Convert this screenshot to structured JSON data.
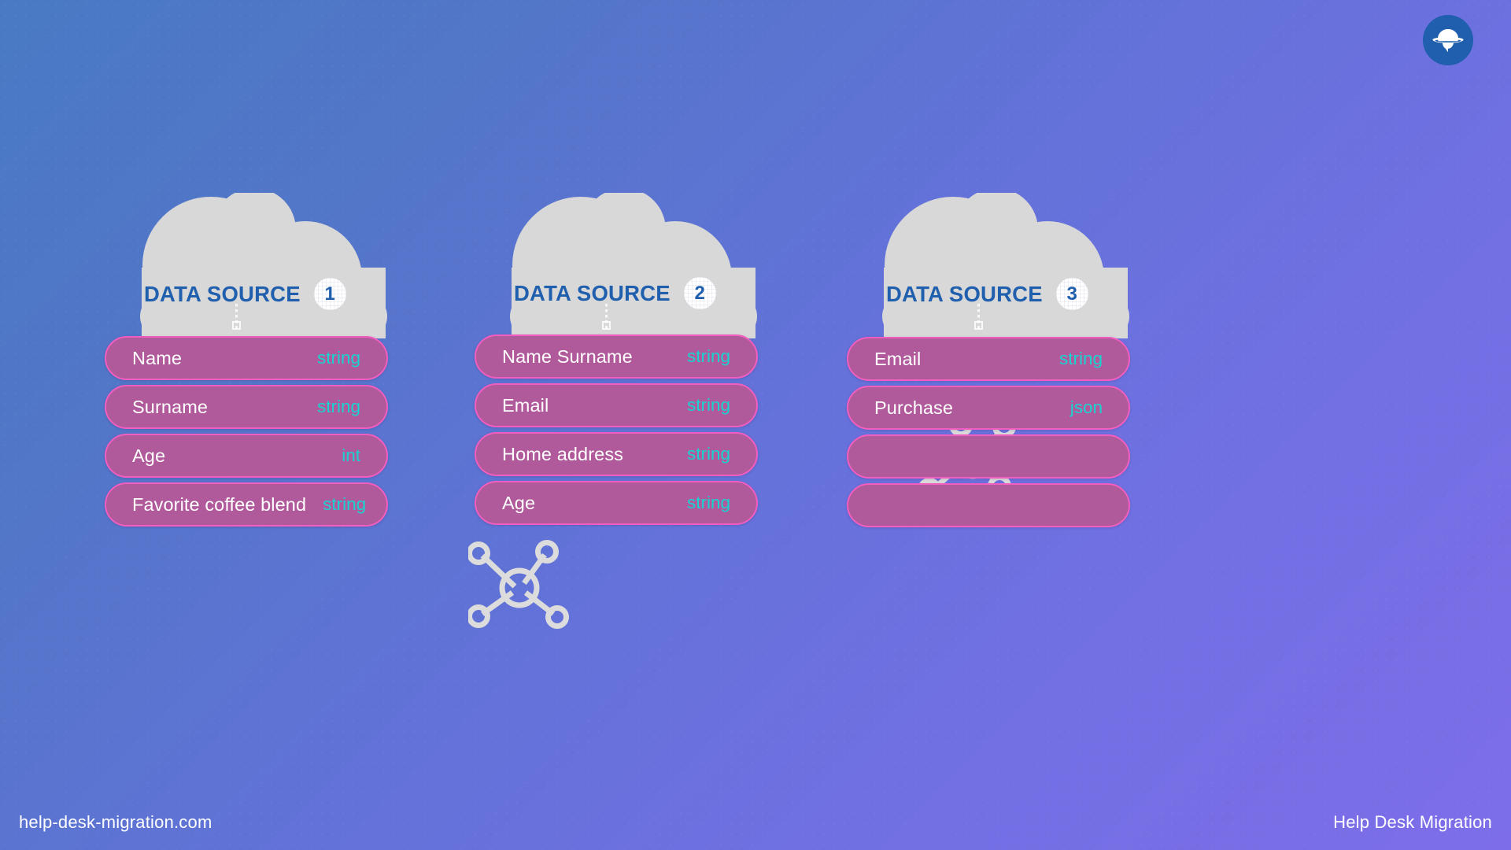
{
  "brand": {
    "logo_icon": "planet-logo-icon",
    "footer_left": "help-desk-migration.com",
    "footer_right": "Help Desk Migration",
    "accent_blue": "#1f5fae",
    "pill_fill": "#b15a9b",
    "pill_border": "#f25ec0",
    "type_color": "#18d3cf",
    "cloud_color": "#d8d8d8"
  },
  "columns": [
    {
      "title": "DATA SOURCE",
      "number": "1",
      "cloud_icon": "cloud-icon",
      "connector_icon": "dotted-connector-icon",
      "fields": [
        {
          "name": "Name",
          "type": "string"
        },
        {
          "name": "Surname",
          "type": "string"
        },
        {
          "name": "Age",
          "type": "int"
        },
        {
          "name": "Favorite coffee blend",
          "type": "string"
        }
      ]
    },
    {
      "title": "DATA SOURCE",
      "number": "2",
      "cloud_icon": "cloud-icon",
      "connector_icon": "dotted-connector-icon",
      "fields": [
        {
          "name": "Name   Surname",
          "type": "string"
        },
        {
          "name": "Email",
          "type": "string"
        },
        {
          "name": "Home address",
          "type": "string"
        },
        {
          "name": "Age",
          "type": "string"
        }
      ]
    },
    {
      "title": "DATA SOURCE",
      "number": "3",
      "cloud_icon": "cloud-icon",
      "connector_icon": "dotted-connector-icon",
      "fields": [
        {
          "name": "Email",
          "type": "string"
        },
        {
          "name": "Purchase",
          "type": "json"
        },
        {
          "name": "",
          "type": ""
        },
        {
          "name": "",
          "type": ""
        }
      ]
    }
  ],
  "node_connectors": [
    {
      "icon": "network-node-icon",
      "label": "mapping-link-1-2"
    },
    {
      "icon": "network-node-icon",
      "label": "mapping-link-2-3"
    }
  ]
}
